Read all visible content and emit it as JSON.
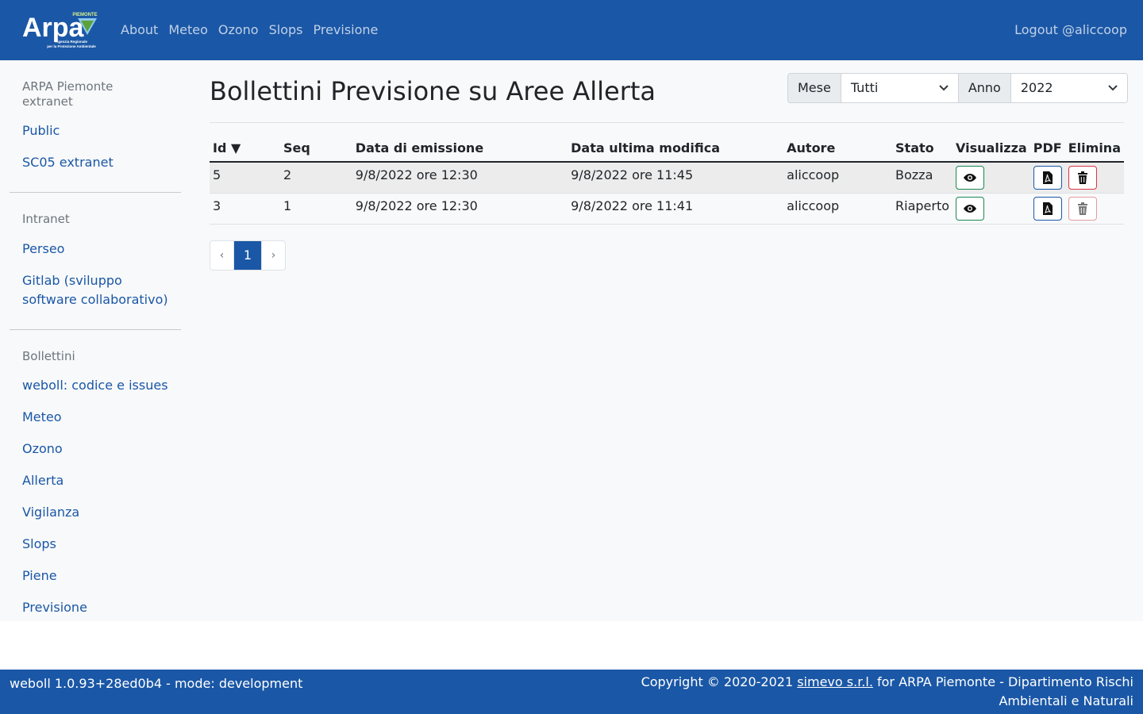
{
  "navbar": {
    "logo_text": "Arpa",
    "logo_tag": "PIEMONTE",
    "logo_sub1": "Agenzia Regionale",
    "logo_sub2": "per la Protezione Ambientale",
    "links": [
      "About",
      "Meteo",
      "Ozono",
      "Slops",
      "Previsione"
    ],
    "logout": "Logout @aliccoop"
  },
  "sidebar": {
    "sections": [
      {
        "heading": "ARPA Piemonte extranet",
        "items": [
          "Public",
          "SC05 extranet"
        ]
      },
      {
        "heading": "Intranet",
        "items": [
          "Perseo",
          "Gitlab (sviluppo software collaborativo)"
        ]
      },
      {
        "heading": "Bollettini",
        "items": [
          "weboll: codice e issues",
          "Meteo",
          "Ozono",
          "Allerta",
          "Vigilanza",
          "Slops",
          "Piene",
          "Previsione"
        ]
      }
    ]
  },
  "main": {
    "title": "Bollettini Previsione su Aree Allerta",
    "filters": {
      "mese_label": "Mese",
      "mese_value": "Tutti",
      "anno_label": "Anno",
      "anno_value": "2022"
    },
    "table": {
      "headers": [
        "Id ▼",
        "Seq",
        "Data di emissione",
        "Data ultima modifica",
        "Autore",
        "Stato",
        "Visualizza",
        "PDF",
        "Elimina"
      ],
      "rows": [
        {
          "id": "5",
          "seq": "2",
          "emissione": "9/8/2022 ore 12:30",
          "modifica": "9/8/2022 ore 11:45",
          "autore": "aliccoop",
          "stato": "Bozza"
        },
        {
          "id": "3",
          "seq": "1",
          "emissione": "9/8/2022 ore 12:30",
          "modifica": "9/8/2022 ore 11:41",
          "autore": "aliccoop",
          "stato": "Riaperto"
        }
      ]
    },
    "pagination": {
      "prev": "‹",
      "current": "1",
      "next": "›"
    }
  },
  "footer": {
    "version": "weboll 1.0.93+28ed0b4 - mode: development",
    "copyright_prefix": "Copyright © 2020-2021 ",
    "company": "simevo s.r.l.",
    "copyright_suffix": " for ARPA Piemonte - Dipartimento Rischi Ambientali e Naturali"
  },
  "colors": {
    "brand": "#1a57a6",
    "view_button": "#198754",
    "delete_button": "#dc3545"
  }
}
